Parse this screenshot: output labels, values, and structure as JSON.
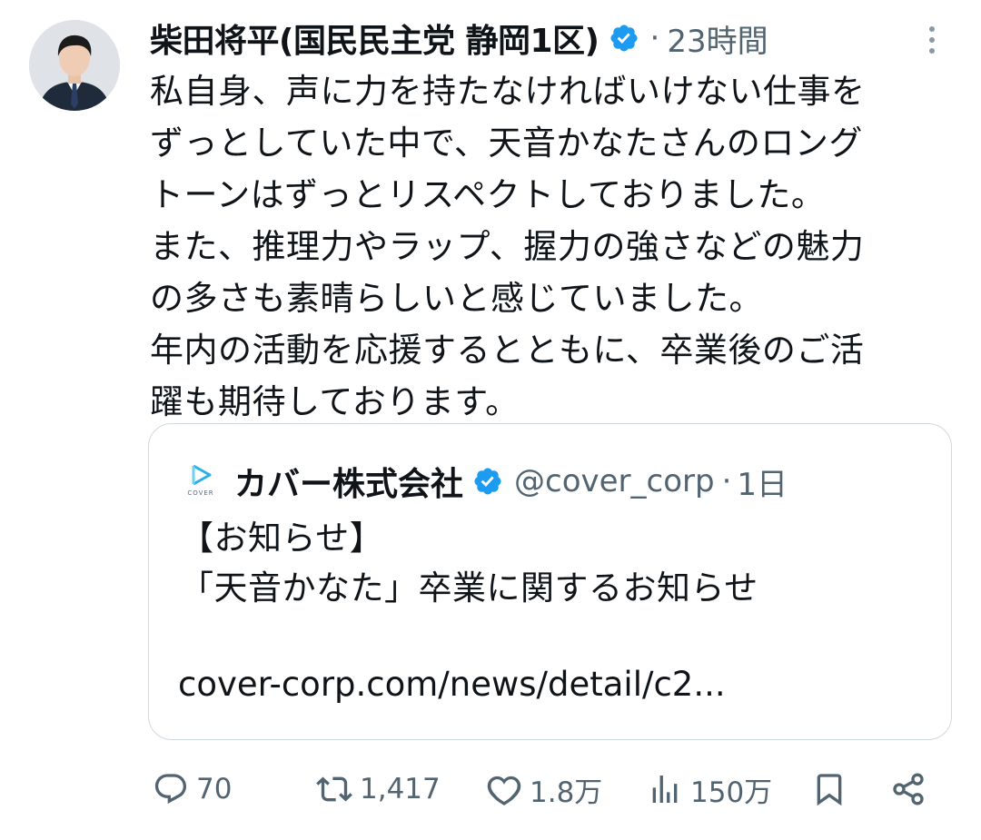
{
  "tweet": {
    "author_name": "柴田将平(国民民主党 静岡1区)",
    "separator": "·",
    "time": "23時間",
    "body_lines": [
      "私自身、声に力を持たなければいけない仕事を",
      "ずっとしていた中で、天音かなたさんのロング",
      "トーンはずっとリスペクトしておりました。",
      "また、推理力やラップ、握力の強さなどの魅力",
      "の多さも素晴らしいと感じていました。",
      "年内の活動を応援するとともに、卒業後のご活",
      "躍も期待しております。"
    ]
  },
  "quote": {
    "logo_text": "COVER",
    "name": "カバー株式会社",
    "handle": "@cover_corp",
    "separator": "·",
    "time": "1日",
    "text_lines": [
      "【お知らせ】",
      "「天音かなた」卒業に関するお知らせ"
    ],
    "link": "cover-corp.com/news/detail/c2..."
  },
  "actions": {
    "replies": "70",
    "reposts": "1,417",
    "likes": "1.8万",
    "views": "150万"
  },
  "colors": {
    "verified_badge": "#1d9bf0",
    "secondary_text": "#536471",
    "border": "#cfd9de",
    "logo_accent": "#2ab0e6"
  },
  "icons": [
    "verified-badge-icon",
    "more-icon",
    "reply-icon",
    "repost-icon",
    "like-icon",
    "views-icon",
    "bookmark-icon",
    "share-icon"
  ]
}
